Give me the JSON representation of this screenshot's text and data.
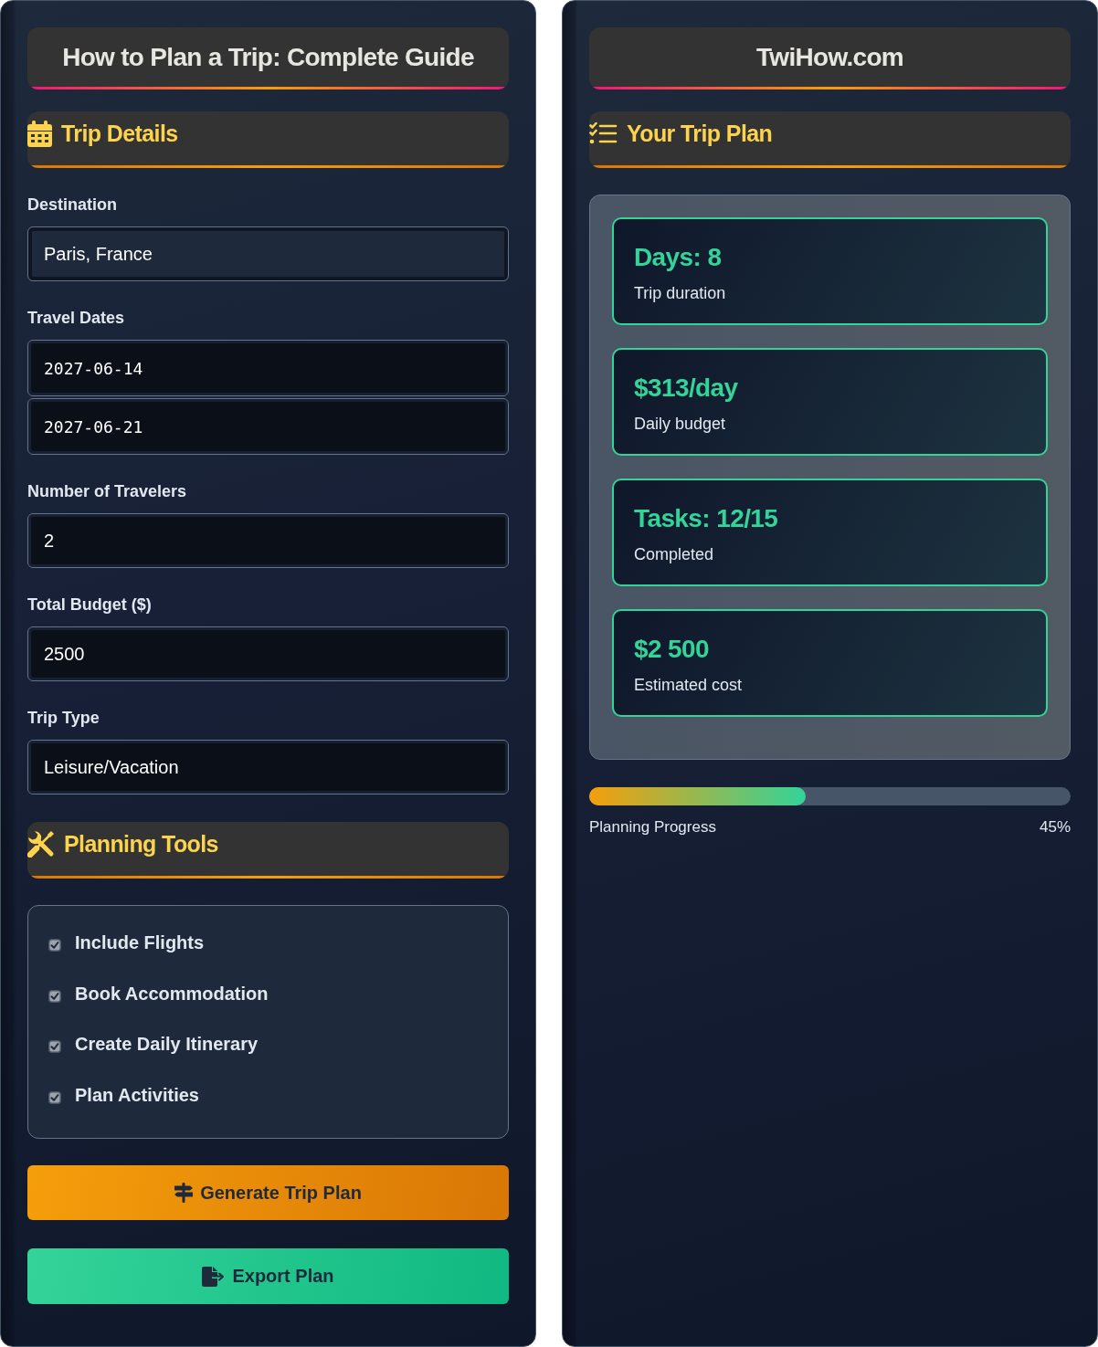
{
  "left": {
    "title": "How to Plan a Trip: Complete Guide",
    "trip_details": {
      "heading": "Trip Details",
      "fields": [
        {
          "label": "Destination",
          "kind": "text",
          "inputs": [
            {
              "value": "Paris, France",
              "focused": true
            }
          ]
        },
        {
          "label": "Travel Dates",
          "kind": "date",
          "inputs": [
            {
              "value": "2027-06-14",
              "focused": false
            },
            {
              "value": "2027-06-21",
              "focused": false
            }
          ]
        },
        {
          "label": "Number of Travelers",
          "kind": "number",
          "inputs": [
            {
              "value": "2",
              "focused": false
            }
          ]
        },
        {
          "label": "Total Budget ($)",
          "kind": "number",
          "inputs": [
            {
              "value": "2500",
              "focused": false
            }
          ]
        },
        {
          "label": "Trip Type",
          "kind": "text",
          "inputs": [
            {
              "value": "Leisure/Vacation",
              "focused": false
            }
          ]
        }
      ]
    },
    "planning_tools": {
      "heading": "Planning Tools",
      "items": [
        {
          "label": "Include Flights",
          "checked": true
        },
        {
          "label": "Book Accommodation",
          "checked": true
        },
        {
          "label": "Create Daily Itinerary",
          "checked": true
        },
        {
          "label": "Plan Activities",
          "checked": true
        }
      ]
    },
    "buttons": [
      {
        "label": "Generate Trip Plan",
        "kind": "generate"
      },
      {
        "label": "Export Plan",
        "kind": "export"
      }
    ]
  },
  "right": {
    "title": "TwiHow.com",
    "plan": {
      "heading": "Your Trip Plan",
      "cards": [
        {
          "value": "Days: 8",
          "caption": "Trip duration"
        },
        {
          "value": "$313/day",
          "caption": "Daily budget"
        },
        {
          "value": "Tasks: 12/15",
          "caption": "Completed"
        },
        {
          "value": "$2 500",
          "caption": "Estimated cost"
        }
      ]
    },
    "progress": {
      "label": "Planning Progress",
      "reading": "45%",
      "level": 0.45
    }
  }
}
